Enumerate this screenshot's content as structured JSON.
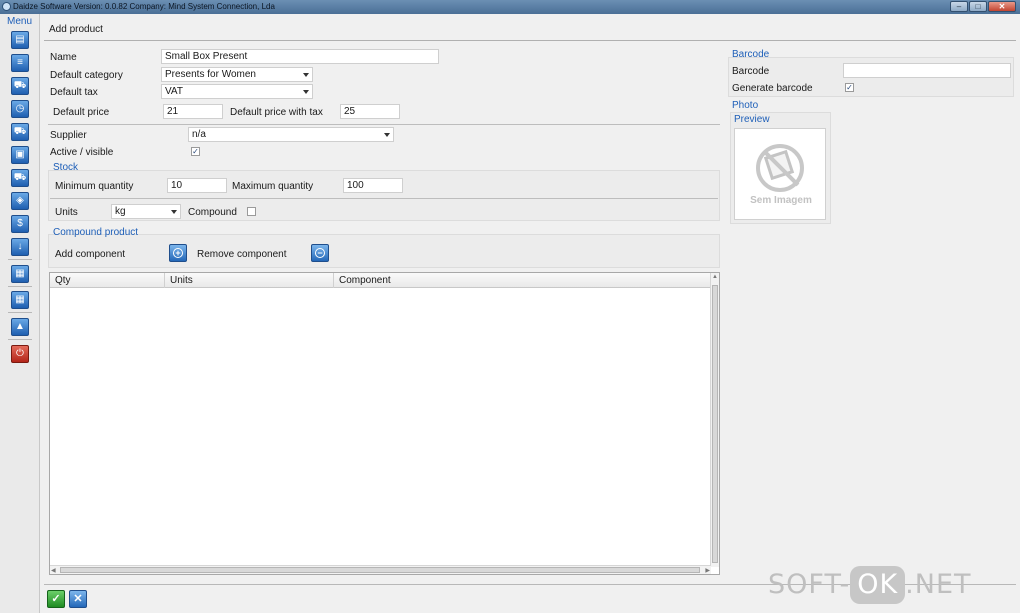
{
  "window": {
    "title": "Daidze Software Version: 0.0.82 Company: Mind System Connection, Lda"
  },
  "menu": {
    "label": "Menu",
    "icons": [
      "calculator-list-icon",
      "document-icon",
      "cart-icon",
      "stopwatch-icon",
      "truck-icon",
      "contact-card-icon",
      "cart-add-icon",
      "tag-icon",
      "dollar-icon",
      "download-icon",
      "report-icon",
      "calculator-icon",
      "warning-icon",
      "power-icon"
    ]
  },
  "form": {
    "header": "Add product",
    "name_label": "Name",
    "name_value": "Small Box Present",
    "category_label": "Default category",
    "category_value": "Presents for Women",
    "tax_label": "Default tax",
    "tax_value": "VAT",
    "price_label": "Default price",
    "price_value": "21",
    "price_tax_label": "Default price with tax",
    "price_tax_value": "25",
    "supplier_label": "Supplier",
    "supplier_value": "n/a",
    "active_label": "Active / visible",
    "active_checked": true
  },
  "stock": {
    "title": "Stock",
    "min_label": "Minimum quantity",
    "min_value": "10",
    "max_label": "Maximum quantity",
    "max_value": "100",
    "units_label": "Units",
    "units_value": "kg",
    "compound_label": "Compound",
    "compound_checked": false
  },
  "compound": {
    "title": "Compound product",
    "add_label": "Add component",
    "remove_label": "Remove component",
    "columns": [
      "Qty",
      "Units",
      "Component"
    ],
    "rows": []
  },
  "barcode": {
    "title": "Barcode",
    "barcode_label": "Barcode",
    "barcode_value": "",
    "generate_label": "Generate barcode",
    "generate_checked": true
  },
  "photo": {
    "title": "Photo",
    "preview_label": "Preview",
    "no_image_text": "Sem Imagem"
  },
  "watermark": {
    "left": "SOFT-",
    "ok": "OK",
    "right": ".NET"
  }
}
